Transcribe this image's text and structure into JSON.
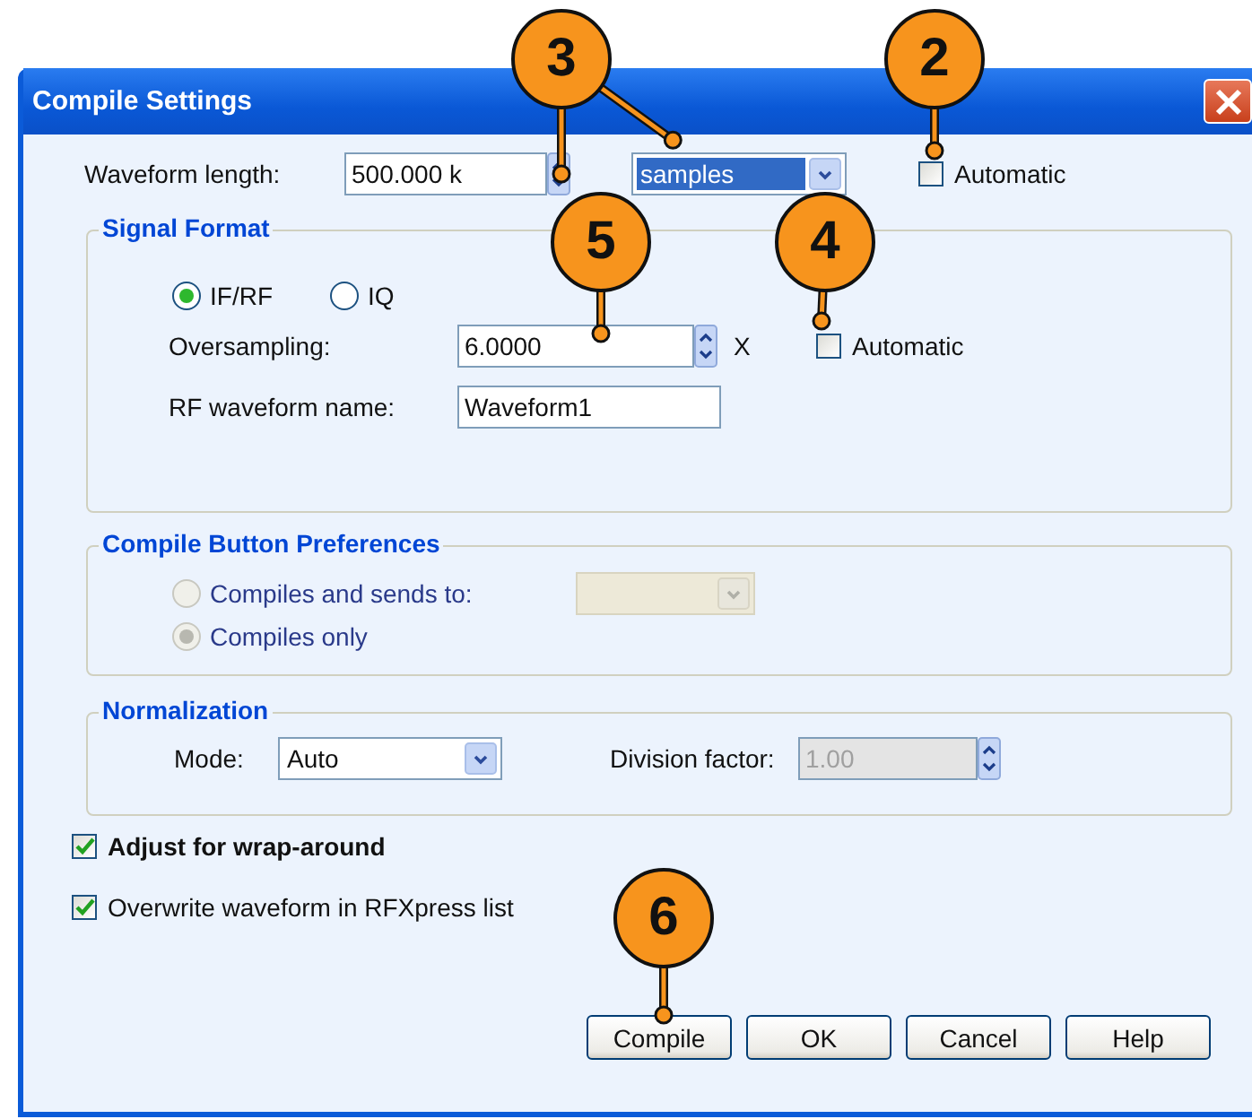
{
  "window": {
    "title": "Compile Settings"
  },
  "waveform_length": {
    "label": "Waveform length:",
    "value": "500.000 k",
    "unit": {
      "value": "samples",
      "focused": true
    },
    "automatic": {
      "label": "Automatic",
      "checked": false
    }
  },
  "signal_format": {
    "title": "Signal Format",
    "formats": [
      {
        "label": "IF/RF",
        "selected": true
      },
      {
        "label": "IQ",
        "selected": false
      }
    ],
    "oversampling": {
      "label": "Oversampling:",
      "value": "6.0000",
      "unit": "X",
      "automatic": {
        "label": "Automatic",
        "checked": false
      }
    },
    "rf_waveform_name": {
      "label": "RF waveform name:",
      "value": "Waveform1"
    }
  },
  "compile_button_preferences": {
    "title": "Compile Button Preferences",
    "disabled": true,
    "options": [
      {
        "label": "Compiles and sends to:",
        "selected": false
      },
      {
        "label": "Compiles only",
        "selected": true
      }
    ]
  },
  "normalization": {
    "title": "Normalization",
    "mode": {
      "label": "Mode:",
      "value": "Auto"
    },
    "division_factor": {
      "label": "Division factor:",
      "value": "1.00",
      "disabled": true
    }
  },
  "options": [
    {
      "label": "Adjust for wrap-around",
      "checked": true,
      "bold": true
    },
    {
      "label": "Overwrite waveform in RFXpress list",
      "checked": true,
      "bold": false
    }
  ],
  "buttons": [
    "Compile",
    "OK",
    "Cancel",
    "Help"
  ],
  "callouts": [
    {
      "label": "3"
    },
    {
      "label": "2"
    },
    {
      "label": "5"
    },
    {
      "label": "4"
    },
    {
      "label": "6"
    }
  ]
}
